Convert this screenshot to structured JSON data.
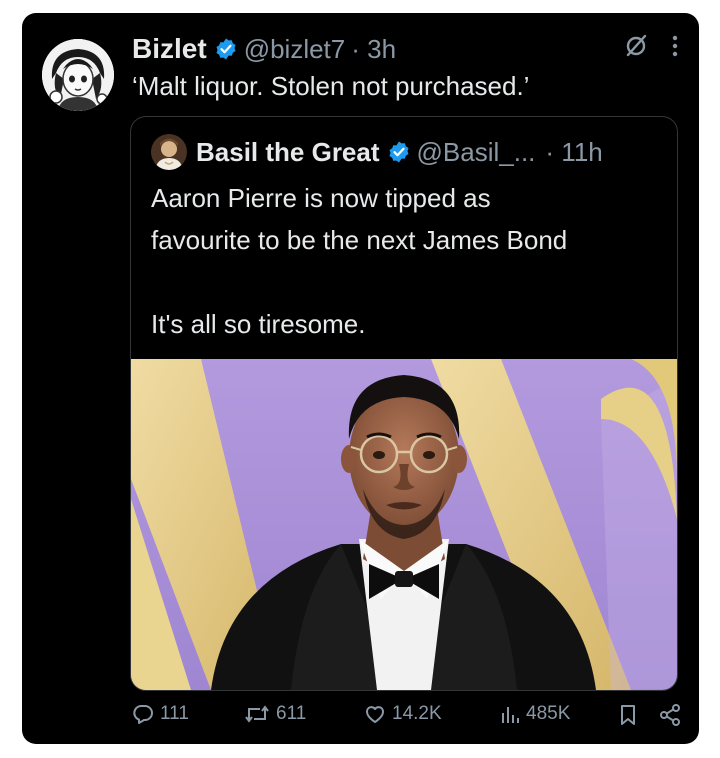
{
  "tweet": {
    "display_name": "Bizlet",
    "handle": "@bizlet7",
    "time": "· 3h",
    "text": "‘Malt liquor. Stolen not purchased.’",
    "avatar_icon": "anime-character-avatar",
    "verified_color": "#1d9bf0"
  },
  "quote": {
    "display_name": "Basil the Great",
    "handle": "@Basil_...",
    "time": "· 11h",
    "lines": [
      "Aaron Pierre is now tipped as",
      "favourite to be the next James Bond",
      "",
      "It's all so tiresome."
    ],
    "avatar_icon": "painting-portrait-avatar",
    "photo": "man-in-tuxedo-with-glasses-on-purple-backdrop"
  },
  "actions": {
    "replies": "111",
    "reposts": "611",
    "likes": "14.2K",
    "views": "485K"
  },
  "colors": {
    "background": "#000000",
    "text": "#e7e9ea",
    "muted": "#8b98a5",
    "border": "#333639",
    "backdrop": "#a98fd6",
    "gold": "#e8cf86"
  }
}
